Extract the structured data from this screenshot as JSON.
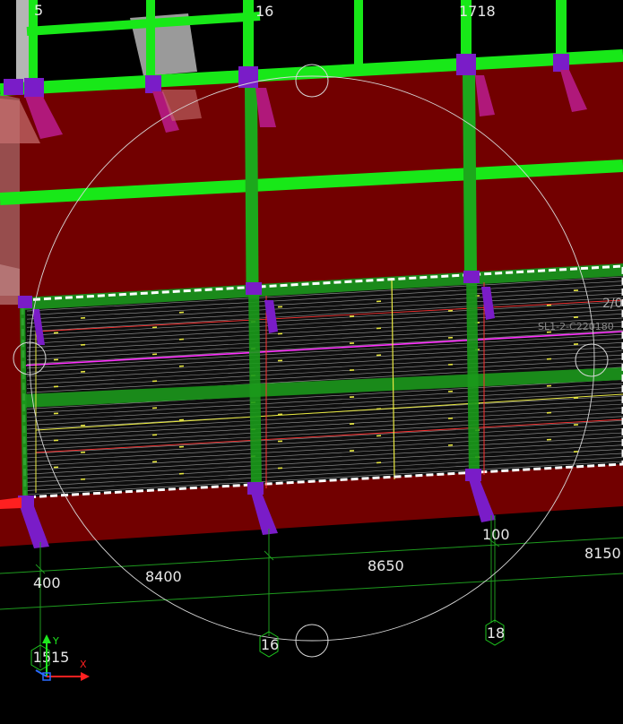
{
  "viewport": {
    "grid_labels": {
      "g5": "5",
      "g16_top": "16",
      "g1718": "1718",
      "g16_bottom": "16",
      "g18_bottom": "18",
      "g15": "1515"
    },
    "dimensions": {
      "d400": "400",
      "d8400": "8400",
      "d8650": "8650",
      "d100": "100",
      "d8150": "8150"
    },
    "annotations": {
      "slab_tag": "SL1-2-C220180",
      "edge_tag": "2/0"
    },
    "ucs": {
      "x_label": "X",
      "y_label": "Y"
    },
    "colors": {
      "background": "#000000",
      "wall_red": "#720000",
      "steel_green": "#18e818",
      "bracket_purple": "#7a1cc8",
      "bracket_magenta": "#b0187a",
      "selection_white": "#ffffff",
      "trim_magenta": "#ff30ff",
      "hatch_yellow": "#e8e840"
    }
  }
}
